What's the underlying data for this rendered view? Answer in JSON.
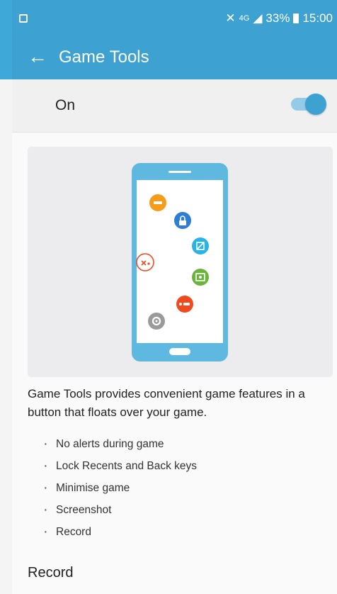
{
  "status_bar": {
    "network": "4G",
    "battery": "33%",
    "time": "15:00"
  },
  "app_bar": {
    "title": "Game Tools",
    "back_icon": "arrow-back-icon"
  },
  "master_switch": {
    "label": "On",
    "state": "on"
  },
  "illustration": {
    "icons": [
      "no-alerts-icon",
      "lock-icon",
      "minimise-icon",
      "gamepad-icon",
      "screenshot-icon",
      "record-icon",
      "settings-icon"
    ]
  },
  "description": "Game Tools provides convenient game features in a button that floats over your game.",
  "features": [
    "No alerts during game",
    "Lock Recents and Back keys",
    "Minimise game",
    "Screenshot",
    "Record"
  ],
  "section_header": "Record",
  "colors": {
    "primary": "#3da2d2",
    "switch_track": "#94cce7",
    "orange": "#f59c1a",
    "blue": "#2d7dd2",
    "cyan": "#2ab3e8",
    "green": "#6cb33e",
    "red": "#f04a1f",
    "grey": "#9a9a9a"
  }
}
